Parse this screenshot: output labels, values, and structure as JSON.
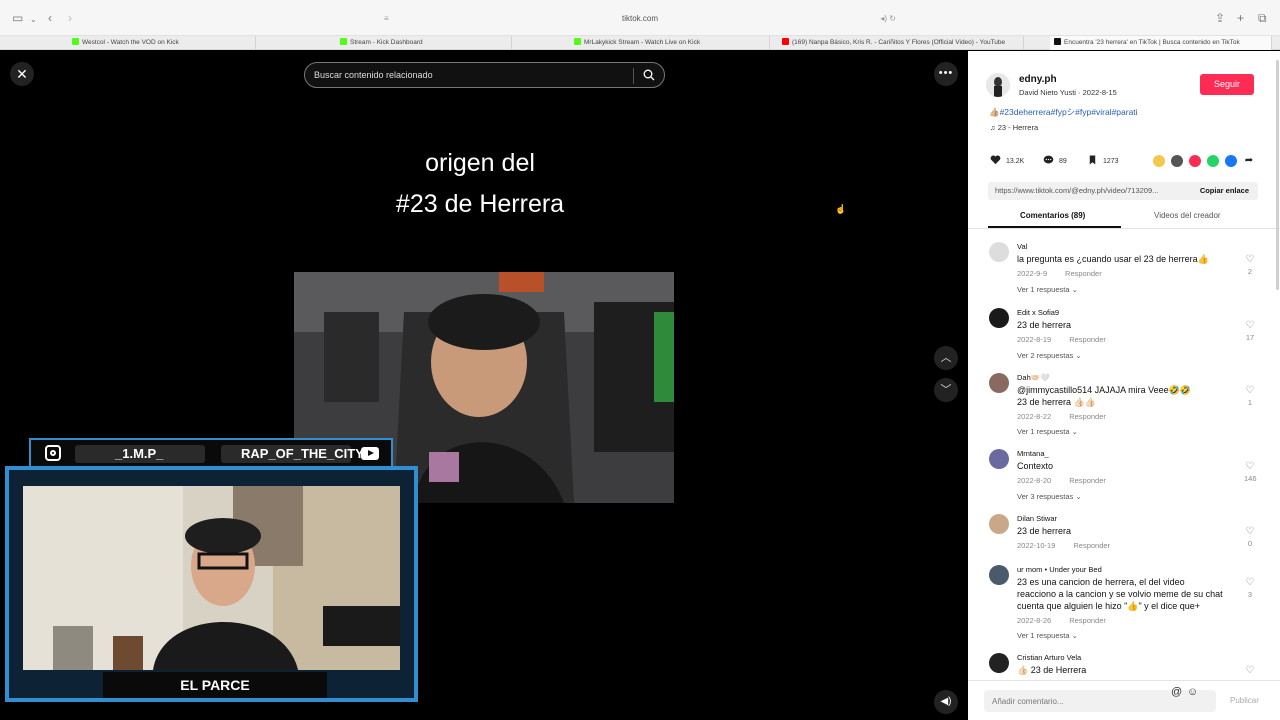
{
  "browser": {
    "url": "tiktok.com",
    "tabs": [
      {
        "label": "Westcol - Watch the VOD on Kick",
        "color": "#53fc18"
      },
      {
        "label": "Stream - Kick Dashboard",
        "color": "#53fc18"
      },
      {
        "label": "MrLakykick Stream - Watch Live on Kick",
        "color": "#53fc18"
      },
      {
        "label": "(169) Nanpa Básico, Kris R. - Cariñitos Y Flores (Official Video) - YouTube",
        "color": "#ff0000"
      },
      {
        "label": "Encuentra '23 herrera' en TikTok | Busca contenido en TikTok",
        "color": "#111111"
      }
    ]
  },
  "video": {
    "search_placeholder": "Buscar contenido relacionado",
    "title_line1": "origen del",
    "title_line2": "#23 de Herrera"
  },
  "overlay": {
    "instagram_handle": "_1.M.P_",
    "youtube_handle": "RAP_OF_THE_CITY",
    "streamer_name": "EL PARCE"
  },
  "post": {
    "username": "edny.ph",
    "subtitle": "David Nieto Yusti · 2022-8-15",
    "follow_label": "Seguir",
    "tags": "👍🏼#23deherrera#fypシ#fyp#viral#parati",
    "music": "♫  23 - Herrera",
    "likes": "13.2K",
    "comments_count": "89",
    "saves": "1273",
    "link": "https://www.tiktok.com/@edny.ph/video/713209...",
    "copy_label": "Copiar enlace",
    "tab_comments": "Comentarios (89)",
    "tab_creator": "Videos del creador"
  },
  "comments": [
    {
      "user": "Val",
      "text": "la pregunta es ¿cuando usar el 23 de herrera👍",
      "date": "2022-9-9",
      "reply": "Responder",
      "more": "Ver 1 respuesta ⌄",
      "likes": "2"
    },
    {
      "user": "Edit x Sofia9",
      "text": "23 de herrera",
      "date": "2022-8-19",
      "reply": "Responder",
      "more": "Ver 2 respuestas ⌄",
      "likes": "17"
    },
    {
      "user": "Dah🤝🏻🤍",
      "text": "@jimmycastillo514 JAJAJA mira Veee🤣🤣",
      "text2": "23 de herrera 👍🏻👍🏻",
      "date": "2022-8-22",
      "reply": "Responder",
      "more": "Ver 1 respuesta ⌄",
      "likes": "1"
    },
    {
      "user": "Mrntana_",
      "text": "Contexto",
      "date": "2022-8-20",
      "reply": "Responder",
      "more": "Ver 3 respuestas ⌄",
      "likes": "146"
    },
    {
      "user": "Dilan Stiwar",
      "text": "23 de herrera",
      "date": "2022-10-19",
      "reply": "Responder",
      "likes": "0"
    },
    {
      "user": "ur mom • Under your Bed",
      "text": "23 es una cancion de herrera, el del video",
      "text2": "reacciono a la cancion y se volvio meme de su chat",
      "text3": "cuenta que alguien le hizo \"👍\" y el dice que+",
      "date": "2022-8-26",
      "reply": "Responder",
      "more": "Ver 1 respuesta ⌄",
      "likes": "3"
    },
    {
      "user": "Cristian Arturo Vela",
      "text": "👍🏻 23 de Herrera",
      "likes": ""
    }
  ],
  "comment_input": {
    "placeholder": "Añadir comentario...",
    "post_label": "Publicar"
  },
  "colors": {
    "accent": "#fe2c55",
    "overlay_border": "#2f8fd0"
  }
}
